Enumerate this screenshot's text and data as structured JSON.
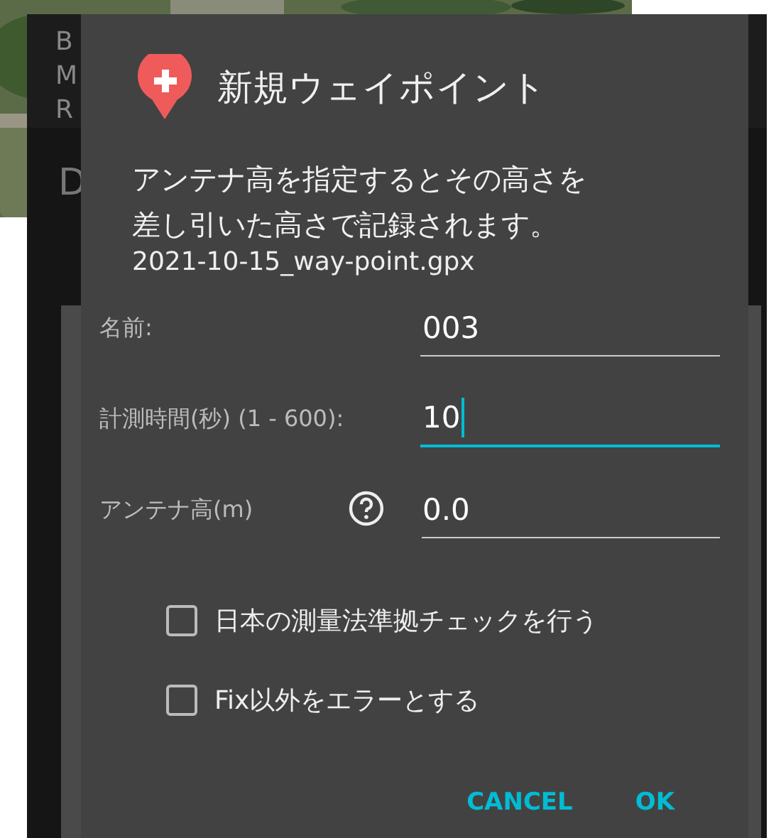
{
  "background": {
    "letters": [
      "B",
      "M",
      "R",
      "D"
    ]
  },
  "dialog": {
    "title": "新規ウェイポイント",
    "message": "アンテナ高を指定するとその高さを差し引いた高さで記録されます。",
    "file": "2021-10-15_way-point.gpx",
    "fields": [
      {
        "label": "名前:",
        "value": "003",
        "focused": false,
        "kind": "plain"
      },
      {
        "label": "計測時間(秒) (1 - 600):",
        "value": "10",
        "focused": true,
        "kind": "plain"
      },
      {
        "label": "アンテナ高(m)",
        "value": "0.0",
        "focused": false,
        "kind": "help"
      }
    ],
    "checkboxes": [
      {
        "label": "日本の測量法準拠チェックを行う",
        "checked": false
      },
      {
        "label": "Fix以外をエラーとする",
        "checked": false
      }
    ],
    "buttons": [
      "CANCEL",
      "OK"
    ]
  }
}
